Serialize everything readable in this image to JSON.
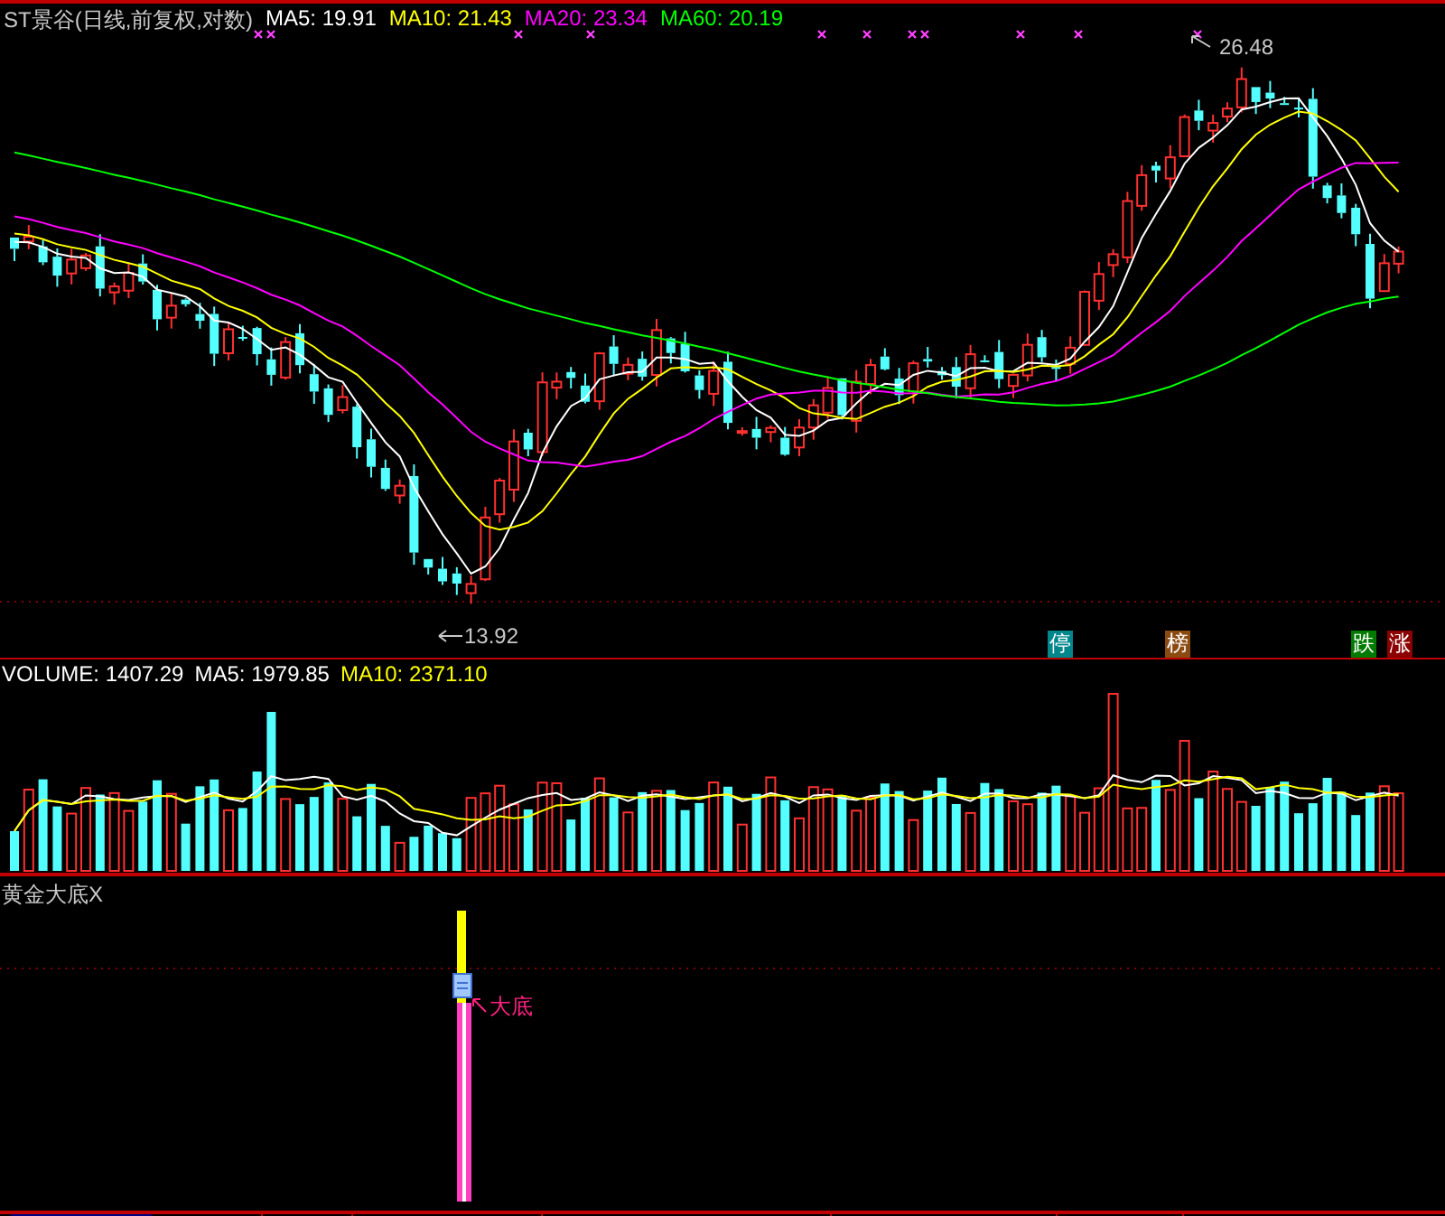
{
  "price_panel": {
    "title": "ST景谷(日线,前复权,对数)",
    "indicators": [
      {
        "label": "MA5: 19.91",
        "color": "#ffffff"
      },
      {
        "label": "MA10: 21.43",
        "color": "#ffff00"
      },
      {
        "label": "MA20: 23.34",
        "color": "#ff00ff"
      },
      {
        "label": "MA60: 20.19",
        "color": "#00ff00"
      }
    ],
    "high_label": "26.48",
    "low_label": "13.92",
    "badges": [
      {
        "text": "停",
        "color": "#00868b"
      },
      {
        "text": "榜",
        "color": "#8b4a10"
      },
      {
        "text": "跌",
        "color": "#007a00"
      },
      {
        "text": "涨",
        "color": "#8b0000"
      }
    ]
  },
  "volume_panel": {
    "indicators": [
      {
        "label": "VOLUME: 1407.29",
        "color": "#ffffff"
      },
      {
        "label": "MA5: 1979.85",
        "color": "#ffffff"
      },
      {
        "label": "MA10: 2371.10",
        "color": "#ffff00"
      }
    ]
  },
  "signal_panel": {
    "title": "黄金大底X",
    "marker_label": "大底"
  }
}
